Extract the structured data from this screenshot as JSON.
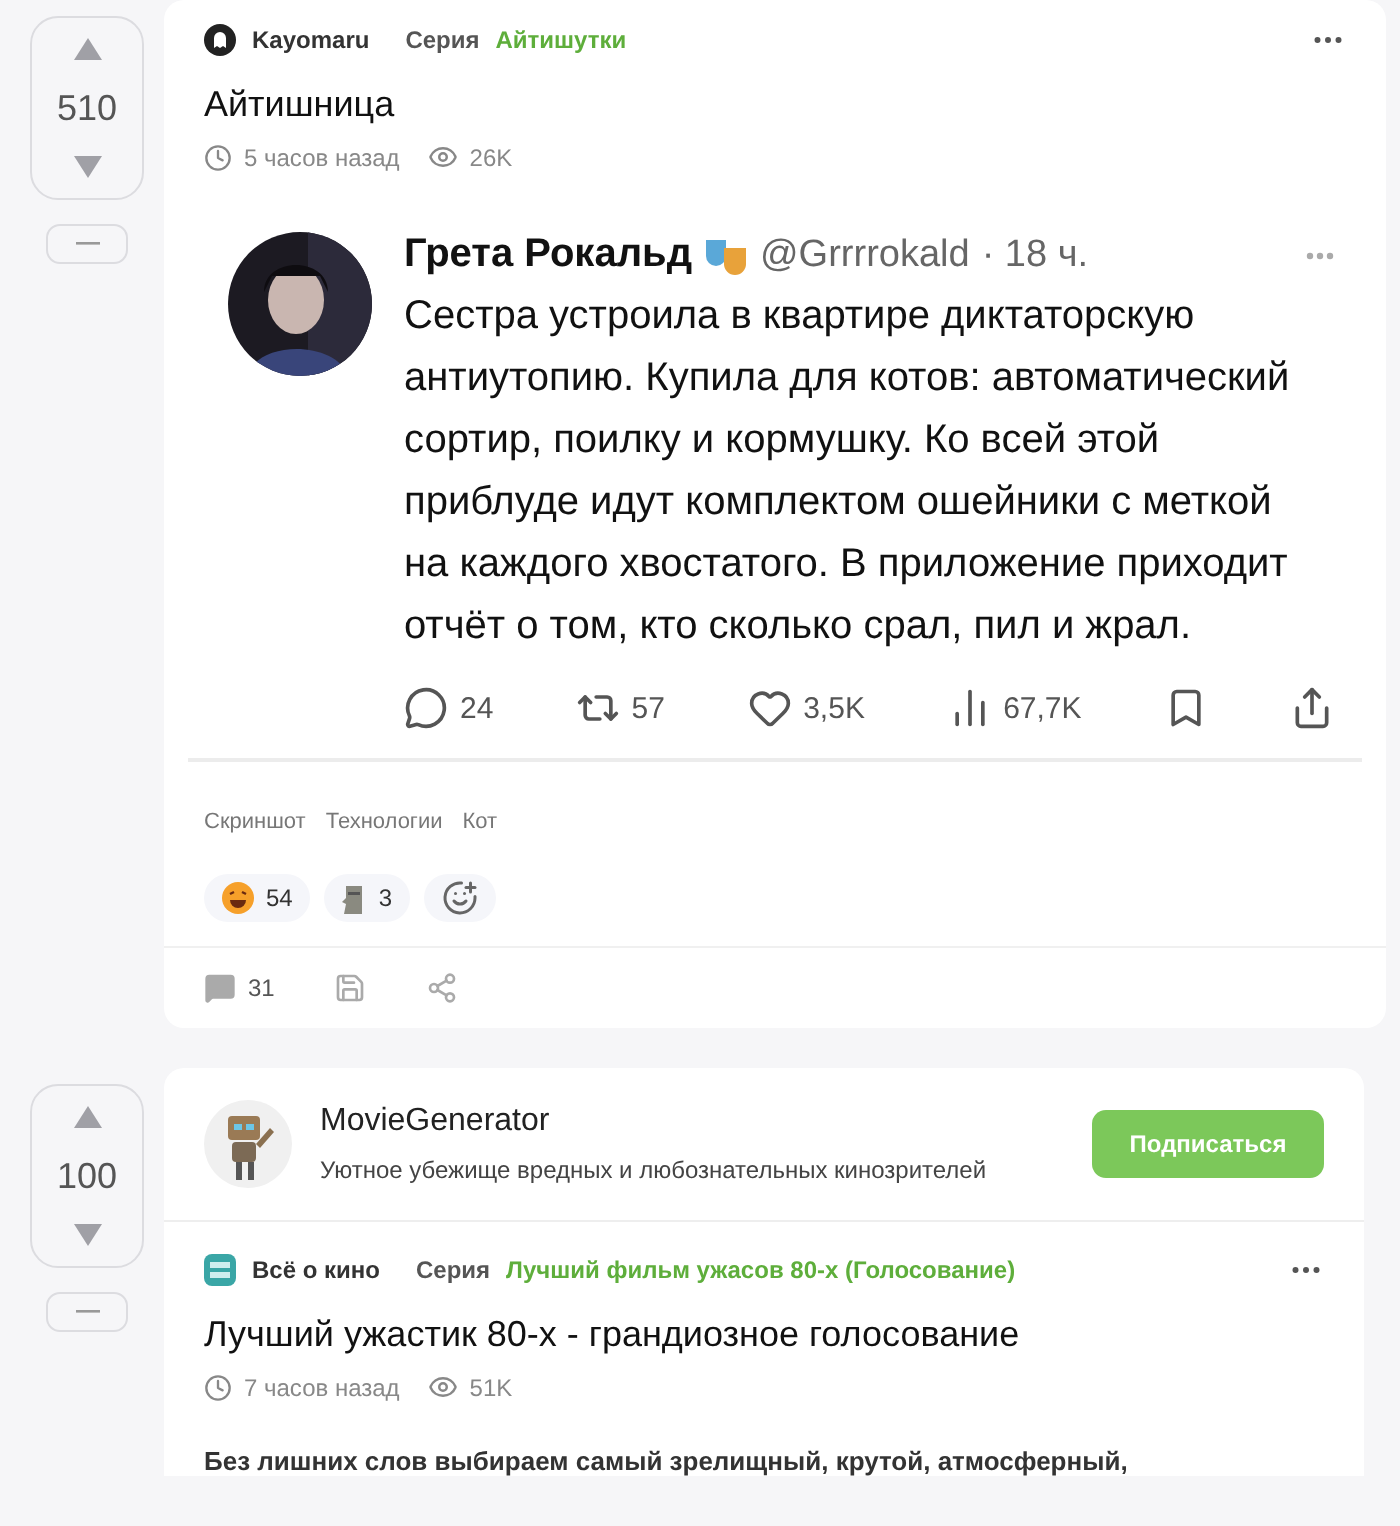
{
  "posts": [
    {
      "vote": {
        "score": "510"
      },
      "author": "Kayomaru",
      "series_label": "Серия",
      "series": "Айтишутки",
      "title": "Айтишница",
      "time": "5 часов назад",
      "views": "26K",
      "tweet": {
        "name": "Грета Рокальд",
        "handle": "@Grrrrokald",
        "time": "· 18 ч.",
        "text": "Сестра устроила в квартире диктаторскую антиутопию. Купила для котов: автоматический сортир, поилку и кормушку. Ко всей этой приблуде идут комплектом ошейники с меткой на каждого хвостатого. В приложение приходит отчёт о том, кто сколько срал, пил и жрал.",
        "stats": [
          {
            "kind": "reply",
            "count": "24"
          },
          {
            "kind": "repost",
            "count": "57"
          },
          {
            "kind": "like",
            "count": "3,5K"
          },
          {
            "kind": "views",
            "count": "67,7K"
          },
          {
            "kind": "bookmark"
          },
          {
            "kind": "share"
          }
        ]
      },
      "tags": [
        "Скриншот",
        "Технологии",
        "Кот"
      ],
      "reactions": [
        {
          "kind": "laugh",
          "count": "54"
        },
        {
          "kind": "moai",
          "count": "3"
        },
        {
          "kind": "add"
        }
      ],
      "comments": "31"
    },
    {
      "vote": {
        "score": "100"
      },
      "community": {
        "name": "MovieGenerator",
        "description": "Уютное убежище вредных и любознательных кинозрителей",
        "button": "Подписаться"
      },
      "author": "Всё о кино",
      "series_label": "Серия",
      "series": "Лучший фильм ужасов 80-х (Голосование)",
      "title": "Лучший ужастик 80-х - грандиозное голосование",
      "time": "7 часов назад",
      "views": "51K",
      "excerpt": "Без лишних слов выбираем самый зрелищный, крутой, атмосферный,"
    }
  ]
}
